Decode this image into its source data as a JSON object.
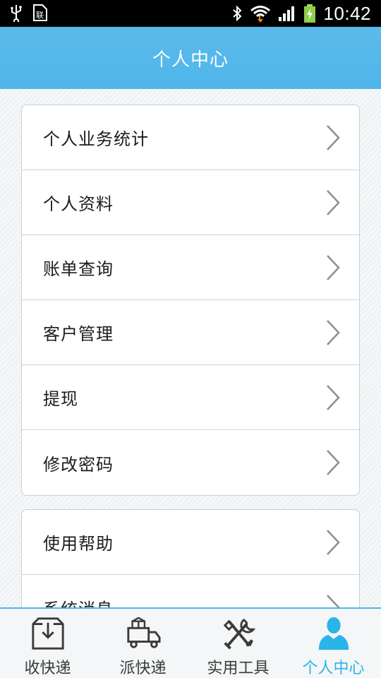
{
  "status_bar": {
    "time": "10:42",
    "icons": [
      "usb-icon",
      "sim-icon",
      "bluetooth-icon",
      "wifi-icon",
      "signal-icon",
      "battery-charging-icon"
    ]
  },
  "header": {
    "title": "个人中心"
  },
  "menu_group_1": {
    "items": [
      {
        "label": "个人业务统计",
        "icon": "chevron-right-icon"
      },
      {
        "label": "个人资料",
        "icon": "chevron-right-icon"
      },
      {
        "label": "账单查询",
        "icon": "chevron-right-icon"
      },
      {
        "label": "客户管理",
        "icon": "chevron-right-icon"
      },
      {
        "label": "提现",
        "icon": "chevron-right-icon"
      },
      {
        "label": "修改密码",
        "icon": "chevron-right-icon"
      }
    ]
  },
  "menu_group_2": {
    "items": [
      {
        "label": "使用帮助",
        "icon": "chevron-right-icon"
      },
      {
        "label": "系统消息",
        "icon": "chevron-right-icon"
      }
    ]
  },
  "tab_bar": {
    "active_color": "#2bb4e8",
    "tabs": [
      {
        "label": "收快递",
        "icon": "inbox-download-icon",
        "active": false
      },
      {
        "label": "派快递",
        "icon": "delivery-truck-icon",
        "active": false
      },
      {
        "label": "实用工具",
        "icon": "tools-icon",
        "active": false
      },
      {
        "label": "个人中心",
        "icon": "person-icon",
        "active": true
      }
    ]
  },
  "colors": {
    "header": "#4fb6ea",
    "accent": "#2bb4e8",
    "background": "#eef2f4"
  }
}
